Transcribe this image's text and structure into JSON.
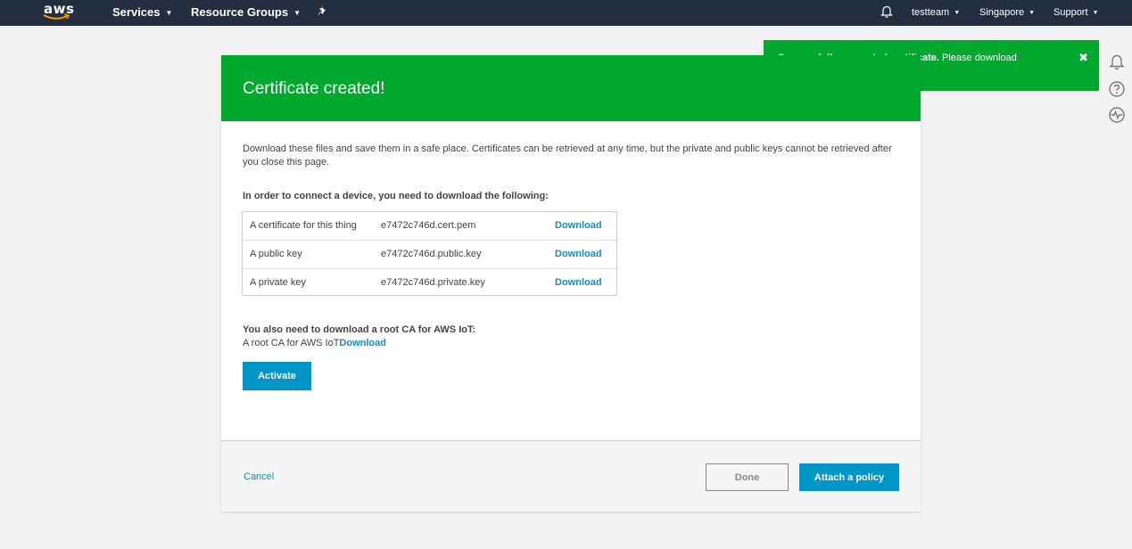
{
  "nav": {
    "logo_text": "aws",
    "services": "Services",
    "resource_groups": "Resource Groups",
    "account": "testteam",
    "region": "Singapore",
    "support": "Support"
  },
  "toast": {
    "bold": "Successfully generated certificate.",
    "text": " Please download certificate files.",
    "close": "✖"
  },
  "modal": {
    "title": "Certificate created!",
    "intro": "Download these files and save them in a safe place. Certificates can be retrieved at any time, but the private and public keys cannot be retrieved after you close this page.",
    "need_title": "In order to connect a device, you need to download the following:",
    "files": [
      {
        "label": "A certificate for this thing",
        "file": "e7472c746d.cert.pem",
        "action": "Download"
      },
      {
        "label": "A public key",
        "file": "e7472c746d.public.key",
        "action": "Download"
      },
      {
        "label": "A private key",
        "file": "e7472c746d.private.key",
        "action": "Download"
      }
    ],
    "root_title": "You also need to download a root CA for AWS IoT:",
    "root_label": "A root CA for AWS IoT",
    "root_action": "Download",
    "activate": "Activate"
  },
  "footer": {
    "cancel": "Cancel",
    "done": "Done",
    "attach": "Attach a policy"
  },
  "colors": {
    "nav_bg": "#232f3e",
    "success_green": "#00a82d",
    "primary_blue": "#0096c8",
    "link_blue": "#0c8ec4"
  },
  "icons": [
    "aws-logo",
    "pin-icon",
    "bell-icon",
    "help-icon",
    "health-icon",
    "close-icon"
  ]
}
